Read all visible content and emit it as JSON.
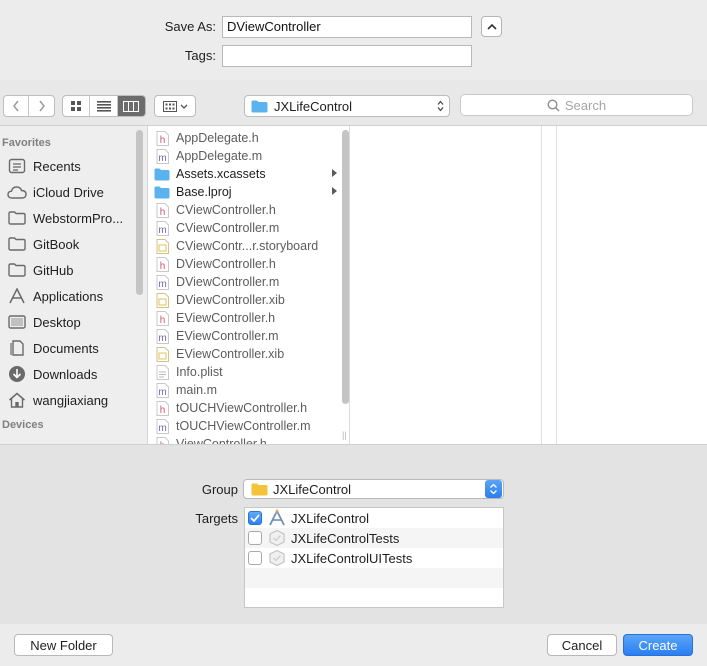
{
  "save_as": {
    "label": "Save As:",
    "value": "DViewController"
  },
  "tags": {
    "label": "Tags:",
    "value": ""
  },
  "toolbar": {
    "location": "JXLifeControl",
    "search_placeholder": "Search"
  },
  "sidebar": {
    "favorites_header": "Favorites",
    "devices_header": "Devices",
    "items": [
      {
        "label": "Recents",
        "icon": "recents-icon"
      },
      {
        "label": "iCloud Drive",
        "icon": "cloud-icon"
      },
      {
        "label": "WebstormPro...",
        "icon": "folder-icon"
      },
      {
        "label": "GitBook",
        "icon": "folder-icon"
      },
      {
        "label": "GitHub",
        "icon": "folder-icon"
      },
      {
        "label": "Applications",
        "icon": "applications-icon"
      },
      {
        "label": "Desktop",
        "icon": "desktop-icon"
      },
      {
        "label": "Documents",
        "icon": "documents-icon"
      },
      {
        "label": "Downloads",
        "icon": "downloads-icon"
      },
      {
        "label": "wangjiaxiang",
        "icon": "home-icon"
      }
    ]
  },
  "files": [
    {
      "name": "AppDelegate.h",
      "kind": "h"
    },
    {
      "name": "AppDelegate.m",
      "kind": "m"
    },
    {
      "name": "Assets.xcassets",
      "kind": "dir"
    },
    {
      "name": "Base.lproj",
      "kind": "dir"
    },
    {
      "name": "CViewController.h",
      "kind": "h"
    },
    {
      "name": "CViewController.m",
      "kind": "m"
    },
    {
      "name": "CViewContr...r.storyboard",
      "kind": "doc"
    },
    {
      "name": "DViewController.h",
      "kind": "h"
    },
    {
      "name": "DViewController.m",
      "kind": "m"
    },
    {
      "name": "DViewController.xib",
      "kind": "doc"
    },
    {
      "name": "EViewController.h",
      "kind": "h"
    },
    {
      "name": "EViewController.m",
      "kind": "m"
    },
    {
      "name": "EViewController.xib",
      "kind": "doc"
    },
    {
      "name": "Info.plist",
      "kind": "plist"
    },
    {
      "name": "main.m",
      "kind": "m"
    },
    {
      "name": "tOUCHViewController.h",
      "kind": "h"
    },
    {
      "name": "tOUCHViewController.m",
      "kind": "m"
    },
    {
      "name": "ViewController.h",
      "kind": "h"
    }
  ],
  "options": {
    "group_label": "Group",
    "group_value": "JXLifeControl",
    "targets_label": "Targets",
    "targets": [
      {
        "name": "JXLifeControl",
        "checked": true,
        "icon": "app-target-icon"
      },
      {
        "name": "JXLifeControlTests",
        "checked": false,
        "icon": "test-target-icon"
      },
      {
        "name": "JXLifeControlUITests",
        "checked": false,
        "icon": "test-target-icon"
      }
    ]
  },
  "footer": {
    "new_folder": "New Folder",
    "cancel": "Cancel",
    "create": "Create"
  },
  "colors": {
    "accent": "#2a7ef1",
    "selected_segment": "#6c6c6c",
    "folder": "#5ab3ef"
  }
}
